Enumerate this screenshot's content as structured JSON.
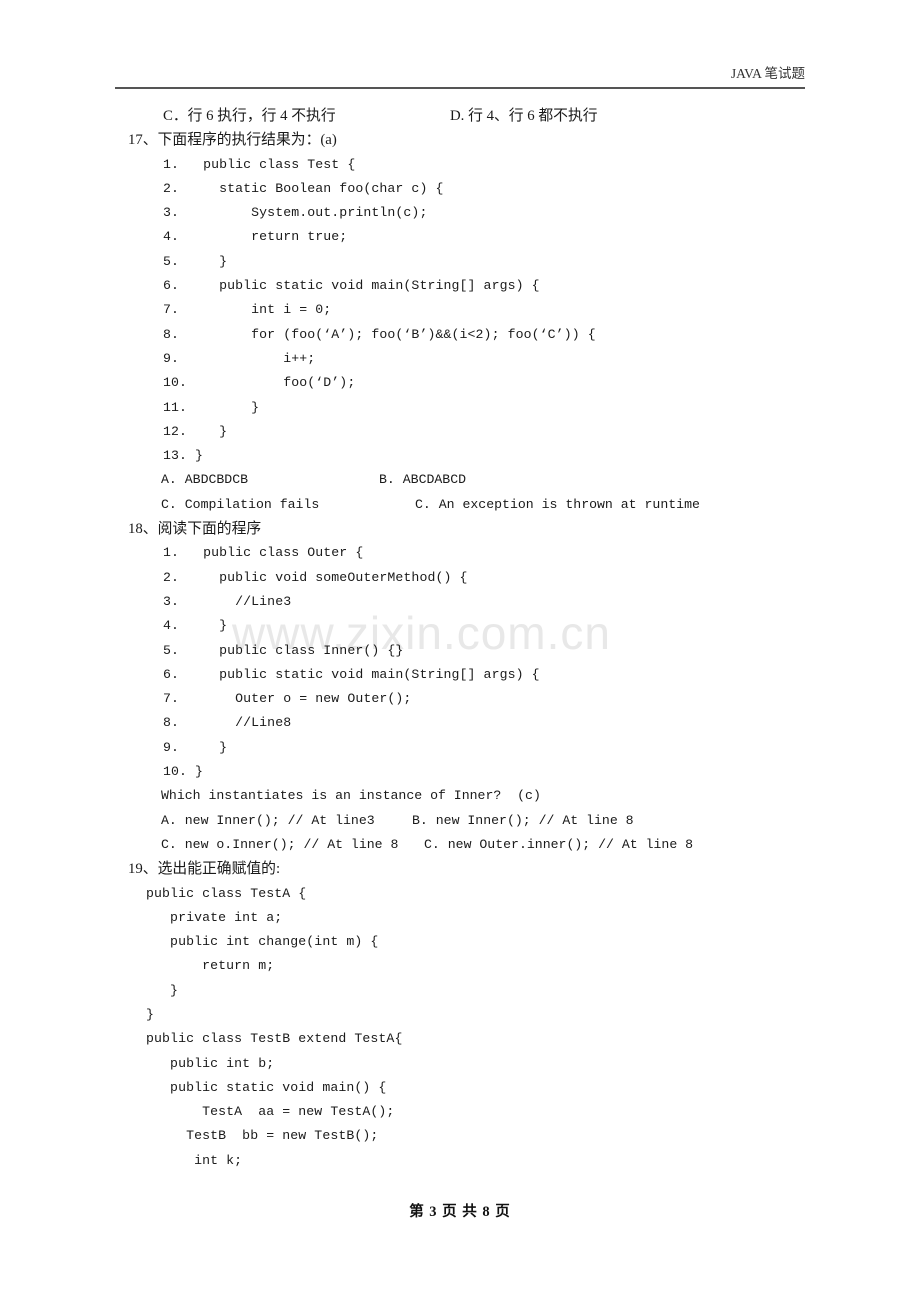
{
  "header": {
    "title": "JAVA 笔试题"
  },
  "watermark": {
    "text": "www.zixin.com.cn"
  },
  "footer": {
    "text": "第 3 页 共 8 页"
  },
  "carryover_options": {
    "left": "C．行 6 执行，行 4 不执行",
    "right": "D. 行 4、行 6 都不执行"
  },
  "q17": {
    "prompt": "17、下面程序的执行结果为：(a)",
    "code": [
      "1.   public class Test {",
      "2.     static Boolean foo(char c) {",
      "3.         System.out.println(c);",
      "4.         return true;",
      "5.     }",
      "6.     public static void main(String[] args) {",
      "7.         int i = 0;",
      "8.         for (foo(‘A’); foo(‘B’)&&(i<2); foo(‘C’)) {",
      "9.             i++;",
      "10.            foo(‘D’);",
      "11.        }",
      "12.    }",
      "13. }"
    ],
    "options": [
      {
        "left": "A. ABDCBDCB",
        "right": "B. ABCDABCD"
      },
      {
        "left": "C. Compilation fails",
        "right": "C. An exception is thrown at runtime"
      }
    ]
  },
  "q18": {
    "prompt": "18、阅读下面的程序",
    "code": [
      "1.   public class Outer {",
      "2.     public void someOuterMethod() {",
      "3.       //Line3",
      "4.     }",
      "5.     public class Inner() {}",
      "6.     public static void main(String[] args) {",
      "7.       Outer o = new Outer();",
      "8.       //Line8",
      "9.     }",
      "10. }"
    ],
    "question": "Which instantiates is an instance of Inner?  (c)",
    "options": [
      {
        "left": "A. new Inner(); // At line3",
        "right": "B. new Inner(); // At line 8"
      },
      {
        "left": "C. new o.Inner(); // At line 8",
        "right": "C. new Outer.inner(); // At line 8"
      }
    ]
  },
  "q19": {
    "prompt": "19、选出能正确赋值的:",
    "code": [
      " public class TestA {",
      "    private int a;",
      "    public int change(int m) {",
      "        return m;",
      "    }",
      " }",
      " public class TestB extend TestA{",
      "    public int b;",
      "    public static void main() {",
      "        TestA  aa = new TestA();",
      "      TestB  bb = new TestB();",
      "       int k;"
    ]
  }
}
